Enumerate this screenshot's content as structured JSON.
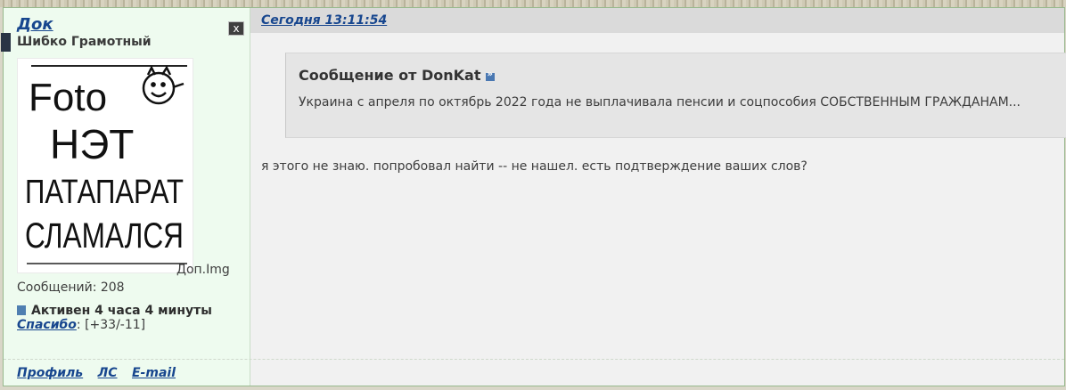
{
  "user": {
    "name": "Док",
    "rank": "Шибко Грамотный",
    "close_label": "x",
    "avatar_text": [
      "Foto",
      "НЭТ",
      "ПАТАПАРАТ",
      "СЛАМАЛСЯ"
    ],
    "extra_image_label": "Доп.Img",
    "messages_label": "Сообщений: 208",
    "active_label": "Активен 4 часа 4 минуты",
    "thanks_link": "Спасибо",
    "thanks_value": ": [+33/-11]"
  },
  "post": {
    "timestamp": "Сегодня 13:11:54",
    "quote": {
      "title": "Сообщение от DonKat",
      "text": "Украина с апреля по октябрь 2022 года не выплачивала пенсии и соцпособия СОБСТВЕННЫМ ГРАЖДАНАМ..."
    },
    "reply": "я этого не знаю. попробовал найти -- не нашел. есть подтверждение ваших слов?"
  },
  "links": {
    "profile": "Профиль",
    "pm": "ЛС",
    "email": "E-mail"
  },
  "colors": {
    "link": "#17468e",
    "panel": "#eefbef",
    "quote_bg": "#e5e5e5",
    "header_bg": "#dadada"
  }
}
